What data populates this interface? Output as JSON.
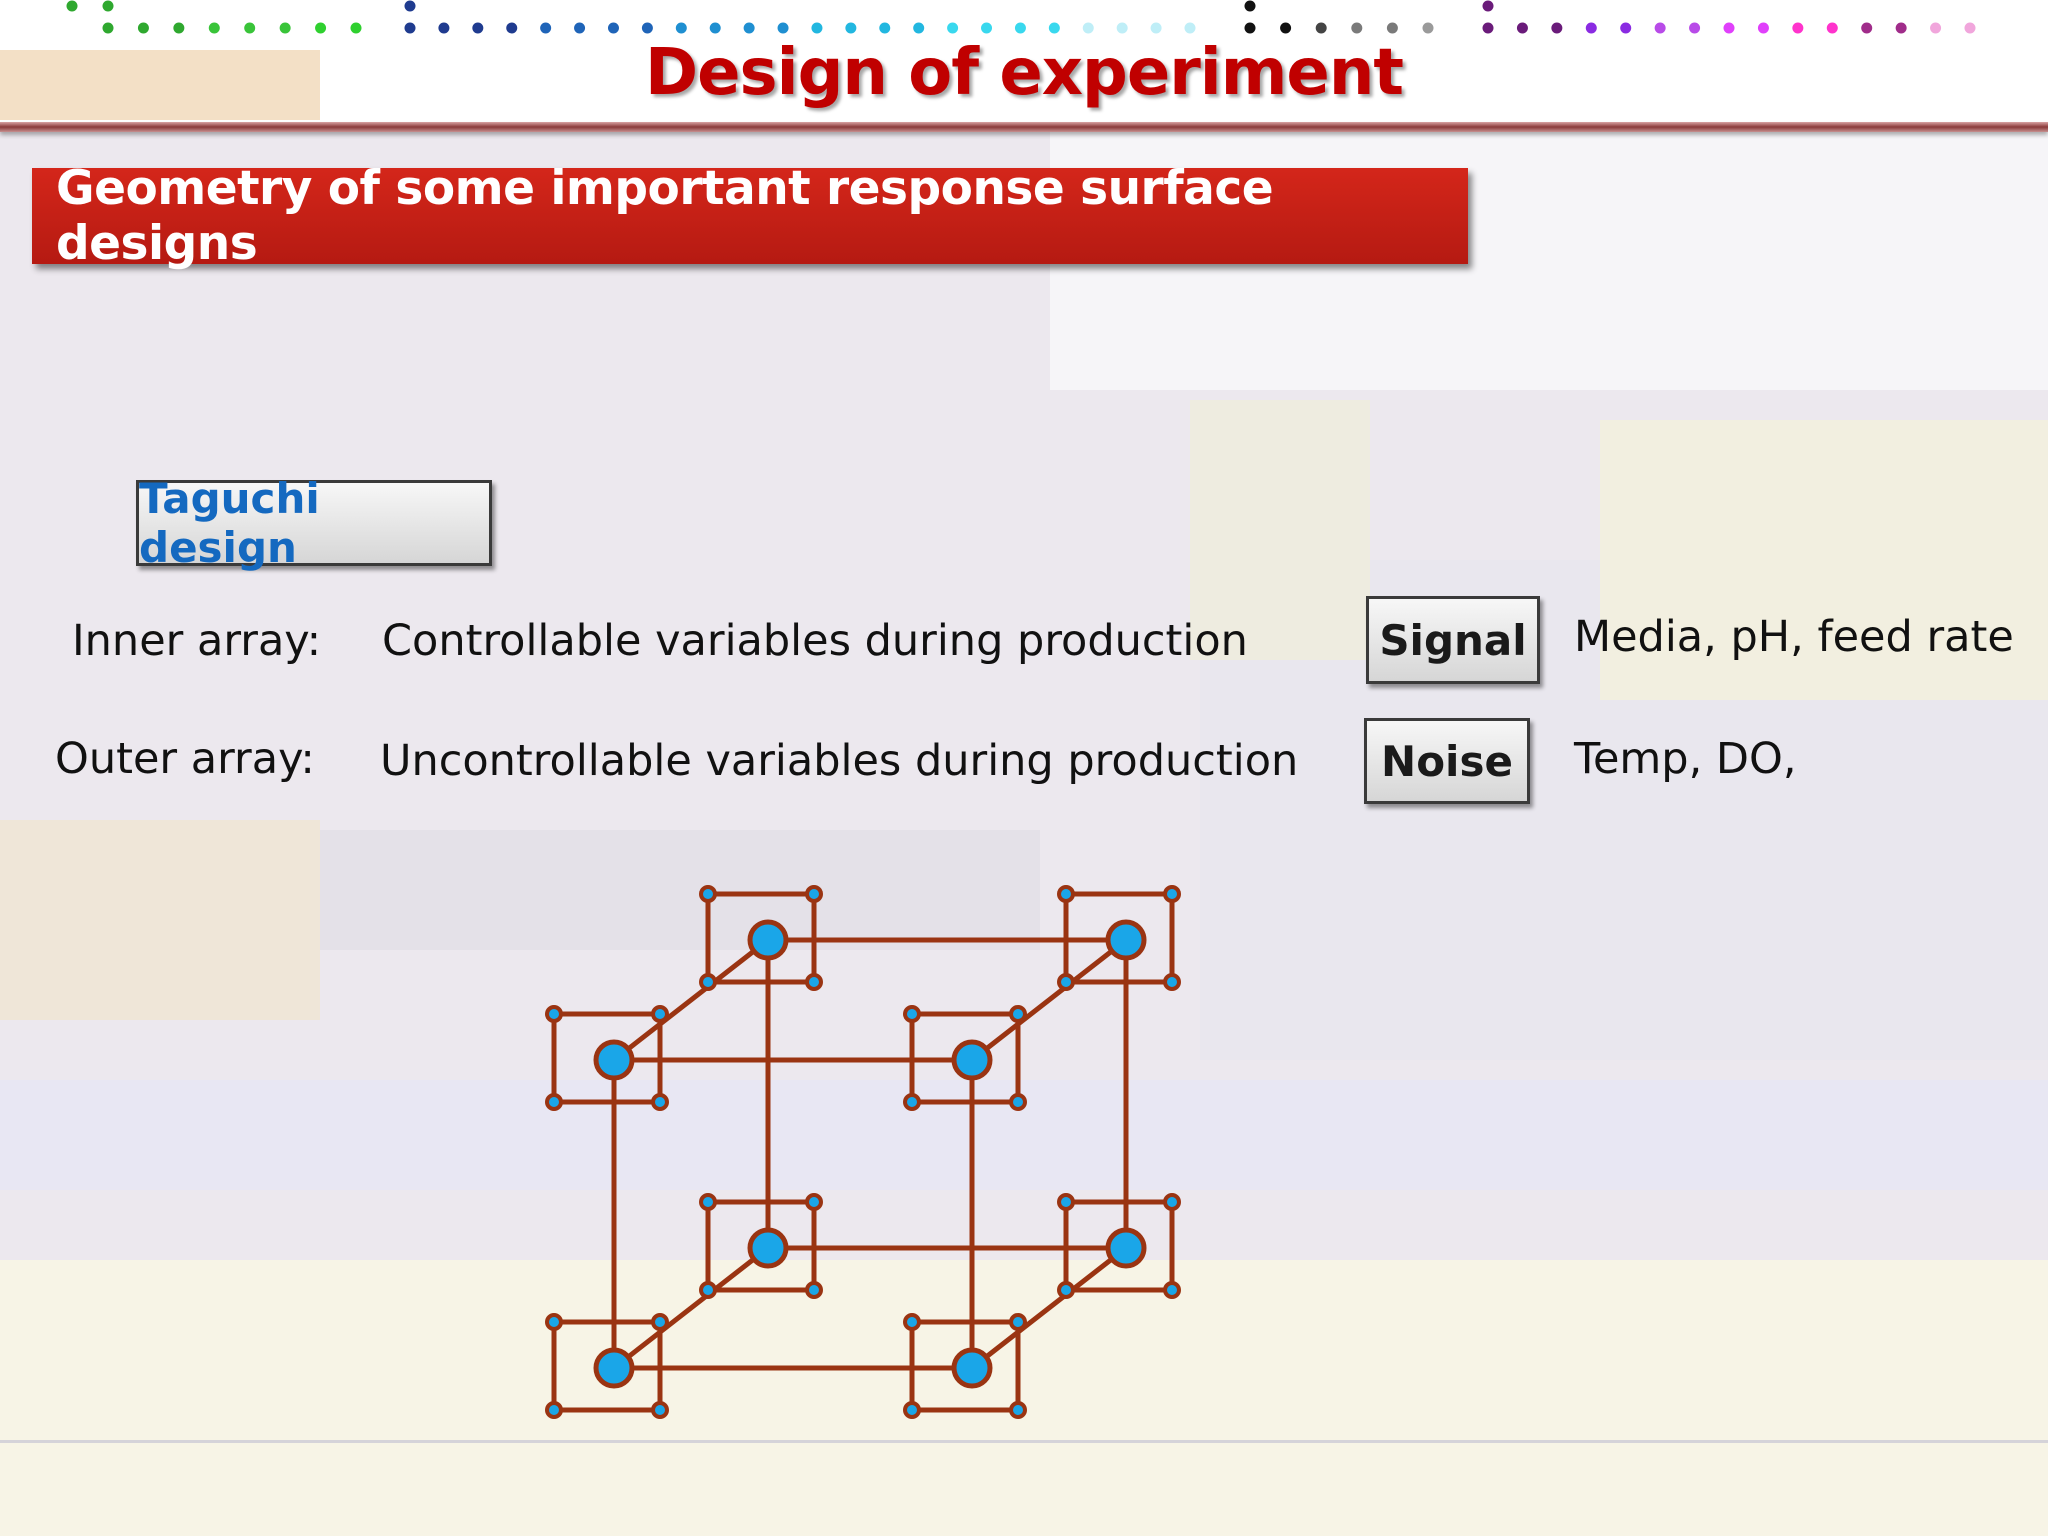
{
  "slide": {
    "title": "Design of experiment",
    "section_title": "Geometry of some important response surface designs",
    "design_name": "Taguchi design"
  },
  "arrays": {
    "inner": {
      "label": "Inner array:",
      "description": "Controllable variables during production"
    },
    "outer": {
      "label": "Outer array:",
      "description": "Uncontrollable variables during production"
    }
  },
  "factors": {
    "signal": {
      "label": "Signal",
      "examples": "Media, pH, feed rate"
    },
    "noise": {
      "label": "Noise",
      "examples": "Temp, DO,"
    }
  },
  "diagram": {
    "description_type": "cube of 8 inner-array design points, each with a square outer array of 4 corner points",
    "line_color": "#9a3412",
    "point_color": "#1aa6e8"
  },
  "colors": {
    "title": "#c00000",
    "banner": "#c8221a",
    "design_label": "#1469c0"
  }
}
